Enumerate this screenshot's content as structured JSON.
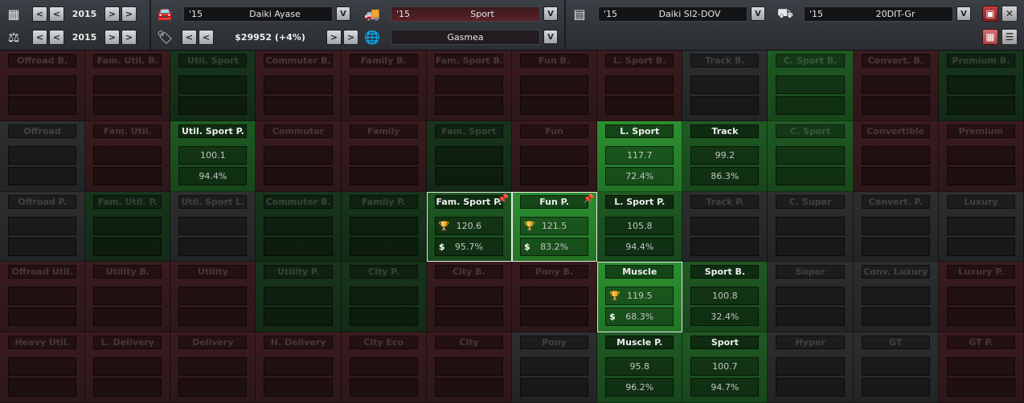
{
  "topbar": {
    "row1_year": "2015",
    "row2_year": "2015",
    "designer": {
      "yr": "'15",
      "name": "Daiki Ayase"
    },
    "segment": {
      "yr": "'15",
      "name": "Sport"
    },
    "engine": {
      "yr": "'15",
      "name": "Daiki SI2-DOV"
    },
    "gearbox": {
      "yr": "'15",
      "name": "20DIT-Gr"
    },
    "price": "$29952 (+4%)",
    "market": "Gasmea",
    "btn_prev": "<",
    "btn_next": ">",
    "btn_v": "V",
    "save_icon": "floppy",
    "close_icon": "x",
    "close_glyph": "✕",
    "grid_icon": "grid",
    "list_icon": "list"
  },
  "grid": [
    [
      {
        "label": "Offroad B.",
        "tint": "red"
      },
      {
        "label": "Fam. Util. B.",
        "tint": "red"
      },
      {
        "label": "Util. Sport",
        "tint": "green1"
      },
      {
        "label": "Commuter B.",
        "tint": "red"
      },
      {
        "label": "Family B.",
        "tint": "red"
      },
      {
        "label": "Fam. Sport B.",
        "tint": "red"
      },
      {
        "label": "Fun B.",
        "tint": "red"
      },
      {
        "label": "L. Sport B.",
        "tint": "red"
      },
      {
        "label": "Track B.",
        "tint": "gray"
      },
      {
        "label": "C. Sport B.",
        "tint": "green2"
      },
      {
        "label": "Convert. B.",
        "tint": "red"
      },
      {
        "label": "Premium B.",
        "tint": "green1"
      }
    ],
    [
      {
        "label": "Offroad",
        "tint": "gray"
      },
      {
        "label": "Fam. Util.",
        "tint": "red"
      },
      {
        "label": "Util. Sport P.",
        "tint": "green2",
        "active": true,
        "v1": "100.1",
        "v2": "94.4%"
      },
      {
        "label": "Commuter",
        "tint": "red"
      },
      {
        "label": "Family",
        "tint": "red"
      },
      {
        "label": "Fam. Sport",
        "tint": "green1"
      },
      {
        "label": "Fun",
        "tint": "red"
      },
      {
        "label": "L. Sport",
        "tint": "green3",
        "active": true,
        "v1": "117.7",
        "v2": "72.4%"
      },
      {
        "label": "Track",
        "tint": "green2",
        "active": true,
        "v1": "99.2",
        "v2": "86.3%"
      },
      {
        "label": "C. Sport",
        "tint": "green2"
      },
      {
        "label": "Convertible",
        "tint": "red"
      },
      {
        "label": "Premium",
        "tint": "red"
      }
    ],
    [
      {
        "label": "Offroad P.",
        "tint": "gray"
      },
      {
        "label": "Fam. Util. P.",
        "tint": "green1"
      },
      {
        "label": "Util. Sport L.",
        "tint": "gray"
      },
      {
        "label": "Commuter B.",
        "tint": "green1"
      },
      {
        "label": "Family P.",
        "tint": "green1"
      },
      {
        "label": "Fam. Sport P.",
        "tint": "green2",
        "active": true,
        "selected": true,
        "pinned": true,
        "v1": "120.6",
        "v2": "95.7%",
        "icons": true
      },
      {
        "label": "Fun P.",
        "tint": "green3",
        "active": true,
        "selected": true,
        "pinned": true,
        "v1": "121.5",
        "v2": "83.2%",
        "icons": true
      },
      {
        "label": "L. Sport P.",
        "tint": "green2",
        "active": true,
        "v1": "105.8",
        "v2": "94.4%"
      },
      {
        "label": "Track P.",
        "tint": "gray"
      },
      {
        "label": "C. Super",
        "tint": "gray"
      },
      {
        "label": "Convert. P.",
        "tint": "gray"
      },
      {
        "label": "Luxury",
        "tint": "gray"
      }
    ],
    [
      {
        "label": "Offroad Util.",
        "tint": "red"
      },
      {
        "label": "Utility B.",
        "tint": "red"
      },
      {
        "label": "Utility",
        "tint": "red"
      },
      {
        "label": "Utility P.",
        "tint": "green1"
      },
      {
        "label": "City P.",
        "tint": "green1"
      },
      {
        "label": "City B.",
        "tint": "red"
      },
      {
        "label": "Pony B.",
        "tint": "red"
      },
      {
        "label": "Muscle",
        "tint": "green3",
        "active": true,
        "selected": true,
        "v1": "119.5",
        "v2": "68.3%",
        "icons": true
      },
      {
        "label": "Sport B.",
        "tint": "green2",
        "active": true,
        "v1": "100.8",
        "v2": "32.4%"
      },
      {
        "label": "Super",
        "tint": "gray"
      },
      {
        "label": "Conv. Luxury",
        "tint": "gray"
      },
      {
        "label": "Luxury P.",
        "tint": "red"
      }
    ],
    [
      {
        "label": "Heavy Util.",
        "tint": "red"
      },
      {
        "label": "L. Delivery",
        "tint": "red"
      },
      {
        "label": "Delivery",
        "tint": "red"
      },
      {
        "label": "H. Delivery",
        "tint": "red"
      },
      {
        "label": "City Eco",
        "tint": "red"
      },
      {
        "label": "City",
        "tint": "red"
      },
      {
        "label": "Pony",
        "tint": "gray"
      },
      {
        "label": "Muscle P.",
        "tint": "green2",
        "active": true,
        "v1": "95.8",
        "v2": "96.2%"
      },
      {
        "label": "Sport",
        "tint": "green2",
        "active": true,
        "v1": "100.7",
        "v2": "94.7%"
      },
      {
        "label": "Hyper",
        "tint": "gray"
      },
      {
        "label": "GT",
        "tint": "gray"
      },
      {
        "label": "GT P.",
        "tint": "red"
      }
    ]
  ]
}
